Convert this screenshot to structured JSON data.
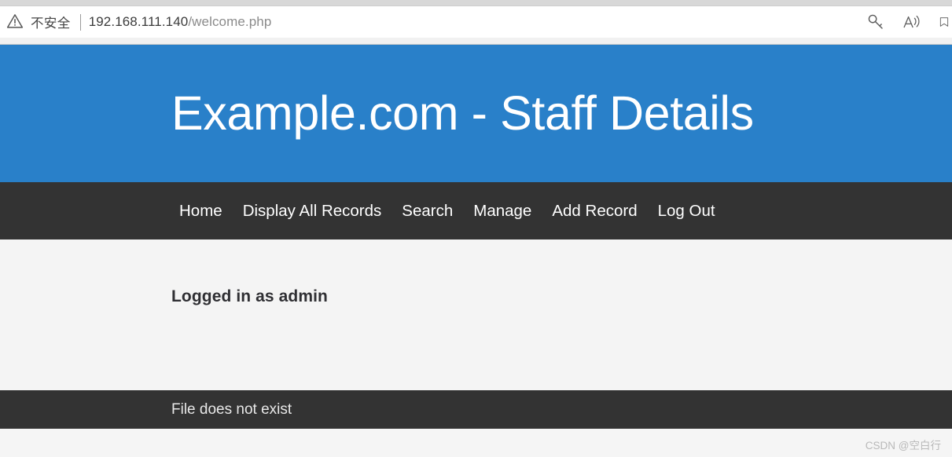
{
  "browser": {
    "security_label": "不安全",
    "security_icon": "warning-triangle-icon",
    "url_domain": "192.168.111.140",
    "url_path": "/welcome.php",
    "actions": [
      {
        "name": "key-icon",
        "label": ""
      },
      {
        "name": "read-aloud-icon",
        "label": ""
      },
      {
        "name": "collections-icon",
        "label": ""
      }
    ]
  },
  "hero": {
    "title": "Example.com - Staff Details",
    "background_color": "#2980c9",
    "text_color": "#ffffff"
  },
  "nav": {
    "background_color": "#333333",
    "items": [
      {
        "label": "Home"
      },
      {
        "label": "Display All Records"
      },
      {
        "label": "Search"
      },
      {
        "label": "Manage"
      },
      {
        "label": "Add Record"
      },
      {
        "label": "Log Out"
      }
    ]
  },
  "main": {
    "heading": "Logged in as admin",
    "background_color": "#f4f4f4"
  },
  "footer": {
    "message": "File does not exist",
    "background_color": "#333333"
  },
  "watermark": {
    "text": "CSDN @空白行"
  }
}
